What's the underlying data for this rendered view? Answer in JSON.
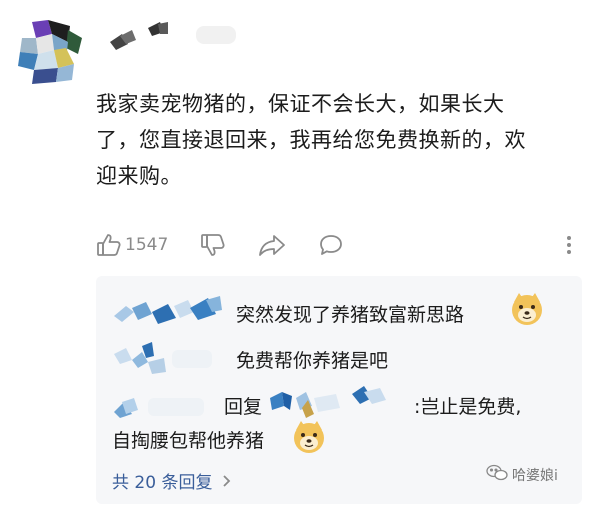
{
  "comment": {
    "line1": "我家卖宠物猪的，保证不会长大，如果长大",
    "line2": "了，您直接退回来，我再给您免费换新的，欢",
    "line3": "迎来购。"
  },
  "actions": {
    "like_count": "1547"
  },
  "replies": [
    {
      "text": "突然发现了养猪致富新思路",
      "emoji": "doge-icon"
    },
    {
      "text": "免费帮你养猪是吧"
    },
    {
      "prefix": "回复",
      "text": ":岂止是免费,",
      "text2": "自掏腰包帮他养猪",
      "emoji": "doge-icon"
    }
  ],
  "more_replies_label": "共 20 条回复",
  "watermark": "哈婆娘i",
  "colors": {
    "link": "#3a5e9a",
    "panel_bg": "#f6f7f9",
    "icon_gray": "#8a8a8a"
  }
}
